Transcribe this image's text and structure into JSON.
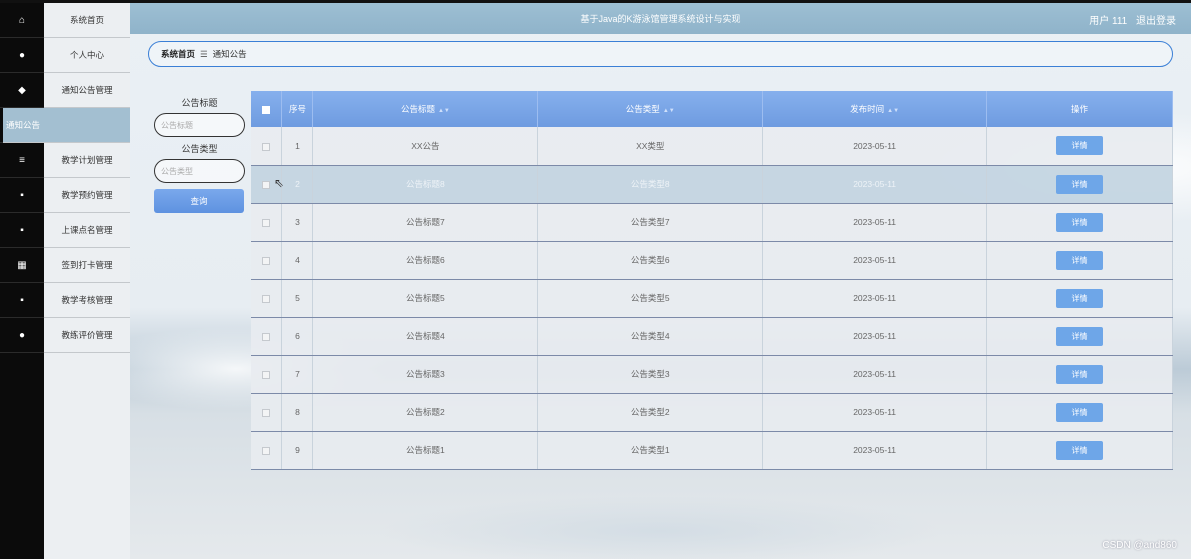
{
  "header": {
    "title": "基于Java的K游泳馆管理系统设计与实现",
    "user": "用户 111",
    "logout": "退出登录"
  },
  "menu": [
    {
      "label": "系统首页",
      "icon": "home-icon",
      "glyph": "⌂"
    },
    {
      "label": "个人中心",
      "icon": "user-icon",
      "glyph": "●"
    },
    {
      "label": "通知公告管理",
      "icon": "megaphone-icon",
      "glyph": "◆"
    },
    {
      "label": "通知公告",
      "icon": "",
      "glyph": ""
    },
    {
      "label": "教学计划管理",
      "icon": "list-icon",
      "glyph": "≡"
    },
    {
      "label": "教学预约管理",
      "icon": "grid-icon",
      "glyph": "▪"
    },
    {
      "label": "上课点名管理",
      "icon": "grid-icon",
      "glyph": "▪"
    },
    {
      "label": "签到打卡管理",
      "icon": "calendar-icon",
      "glyph": "▦"
    },
    {
      "label": "教学考核管理",
      "icon": "grid-icon",
      "glyph": "▪"
    },
    {
      "label": "教练评价管理",
      "icon": "user-icon",
      "glyph": "●"
    }
  ],
  "breadcrumb": {
    "home": "系统首页",
    "sep": "☰",
    "current": "通知公告"
  },
  "search": {
    "title_label": "公告标题",
    "title_placeholder": "公告标题",
    "type_label": "公告类型",
    "type_placeholder": "公告类型",
    "button": "查询"
  },
  "table": {
    "columns": [
      "序号",
      "公告标题",
      "公告类型",
      "发布时间",
      "操作"
    ],
    "rows": [
      {
        "no": "1",
        "title": "XX公告",
        "type": "XX类型",
        "date": "2023-05-11",
        "action": "详情"
      },
      {
        "no": "2",
        "title": "公告标题8",
        "type": "公告类型8",
        "date": "2023-05-11",
        "action": "详情"
      },
      {
        "no": "3",
        "title": "公告标题7",
        "type": "公告类型7",
        "date": "2023-05-11",
        "action": "详情"
      },
      {
        "no": "4",
        "title": "公告标题6",
        "type": "公告类型6",
        "date": "2023-05-11",
        "action": "详情"
      },
      {
        "no": "5",
        "title": "公告标题5",
        "type": "公告类型5",
        "date": "2023-05-11",
        "action": "详情"
      },
      {
        "no": "6",
        "title": "公告标题4",
        "type": "公告类型4",
        "date": "2023-05-11",
        "action": "详情"
      },
      {
        "no": "7",
        "title": "公告标题3",
        "type": "公告类型3",
        "date": "2023-05-11",
        "action": "详情"
      },
      {
        "no": "8",
        "title": "公告标题2",
        "type": "公告类型2",
        "date": "2023-05-11",
        "action": "详情"
      },
      {
        "no": "9",
        "title": "公告标题1",
        "type": "公告类型1",
        "date": "2023-05-11",
        "action": "详情"
      }
    ]
  },
  "watermark": "CSDN @and860",
  "colors": {
    "header": "#94b8ce",
    "table_head": "#7aa6e8",
    "accent": "#3a7fd6"
  }
}
